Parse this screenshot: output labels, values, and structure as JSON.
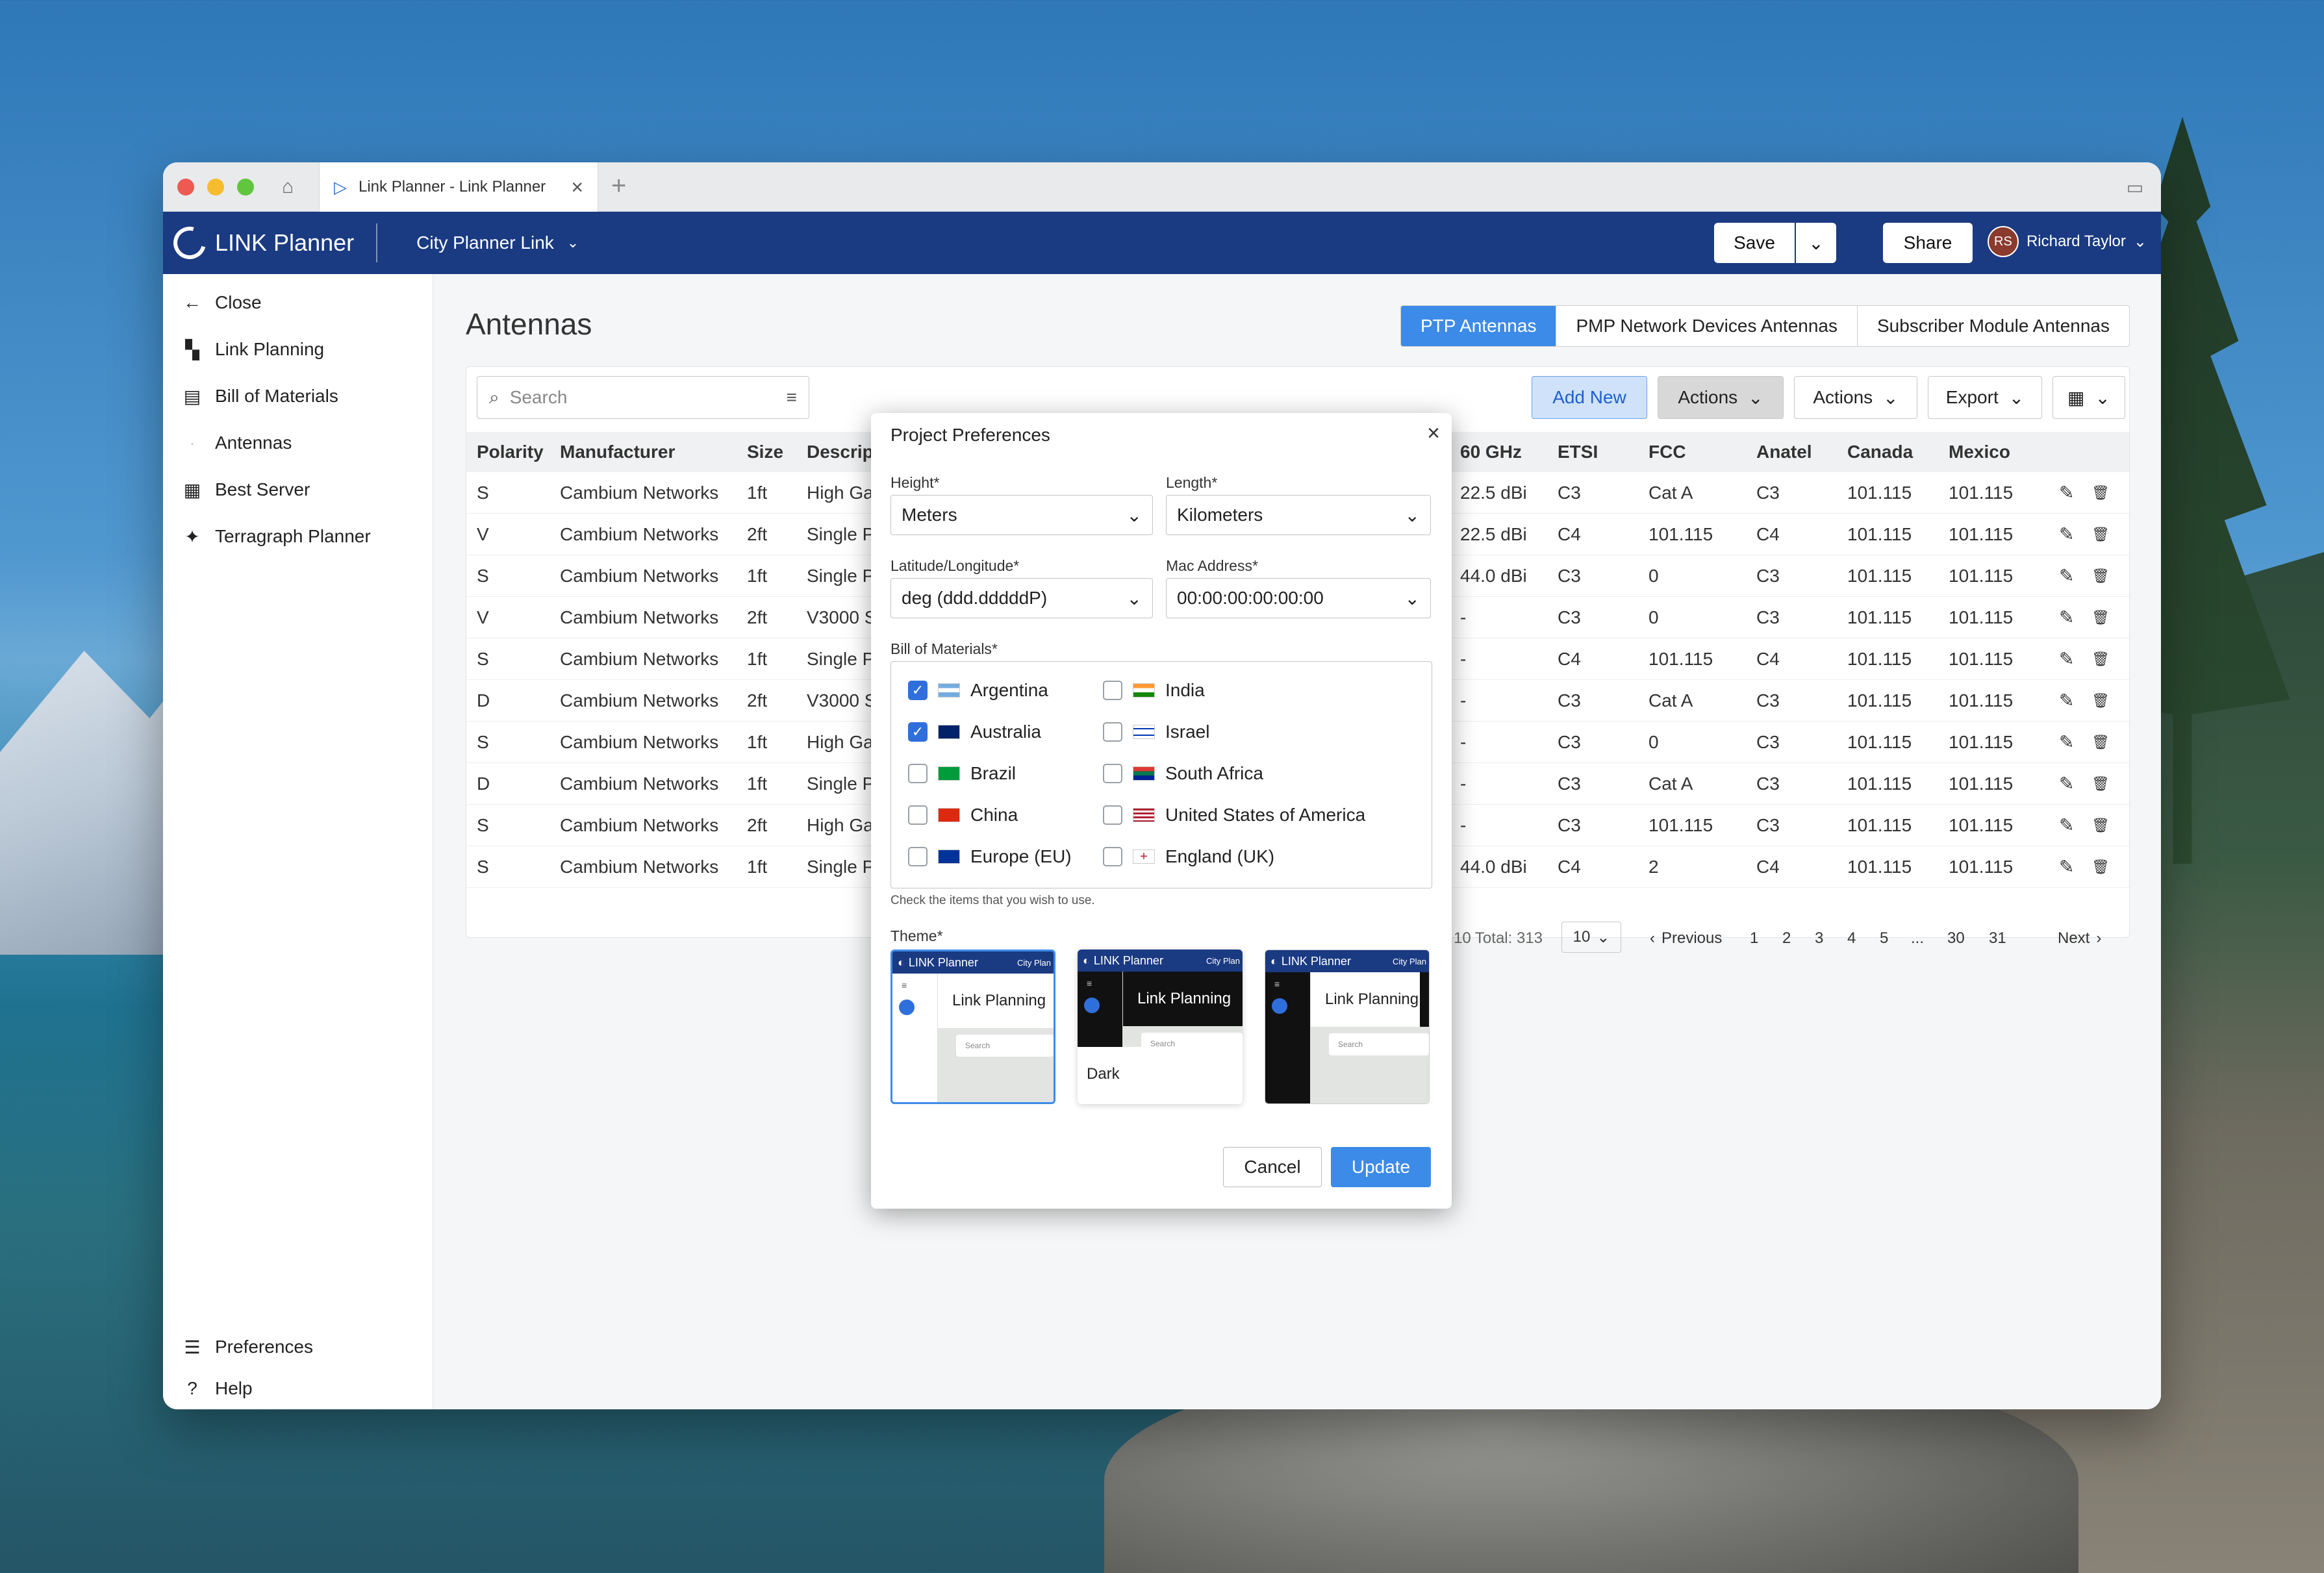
{
  "browser": {
    "tab_title": "Link Planner - Link Planner"
  },
  "app": {
    "logo": "LINK Planner",
    "project": "City Planner Link",
    "save": "Save",
    "share": "Share",
    "user_initials": "RS",
    "user_name": "Richard Taylor"
  },
  "sidebar": {
    "items": [
      {
        "label": "Close",
        "icon": "arrow-left-icon"
      },
      {
        "label": "Link Planning",
        "icon": "map-icon"
      },
      {
        "label": "Bill of Materials",
        "icon": "bom-icon"
      },
      {
        "label": "Antennas",
        "icon": "antenna-icon"
      },
      {
        "label": "Best Server",
        "icon": "server-icon"
      },
      {
        "label": "Terragraph Planner",
        "icon": "puzzle-icon"
      }
    ],
    "bottom": [
      {
        "label": "Preferences",
        "icon": "sliders-icon"
      },
      {
        "label": "Help",
        "icon": "help-icon"
      }
    ]
  },
  "page": {
    "title": "Antennas",
    "tabs": [
      "PTP Antennas",
      "PMP Network Devices Antennas",
      "Subscriber Module Antennas"
    ],
    "search_placeholder": "Search",
    "toolbar": {
      "add_new": "Add New",
      "actions1": "Actions",
      "actions2": "Actions",
      "export": "Export"
    }
  },
  "table": {
    "left_headers": [
      "Polarity",
      "Manufacturer",
      "Size",
      "Descript"
    ],
    "right_headers": [
      "60 GHz",
      "ETSI",
      "FCC",
      "Anatel",
      "Canada",
      "Mexico"
    ],
    "rows": [
      [
        "S",
        "Cambium Networks",
        "1ft",
        "High Ga",
        "22.5 dBi",
        "C3",
        "Cat A",
        "C3",
        "101.115",
        "101.115"
      ],
      [
        "V",
        "Cambium Networks",
        "2ft",
        "Single P",
        "22.5 dBi",
        "C4",
        "101.115",
        "C4",
        "101.115",
        "101.115"
      ],
      [
        "S",
        "Cambium Networks",
        "1ft",
        "Single P",
        "44.0 dBi",
        "C3",
        "0",
        "C3",
        "101.115",
        "101.115"
      ],
      [
        "V",
        "Cambium Networks",
        "2ft",
        "V3000 S",
        "-",
        "C3",
        "0",
        "C3",
        "101.115",
        "101.115"
      ],
      [
        "S",
        "Cambium Networks",
        "1ft",
        "Single P",
        "-",
        "C4",
        "101.115",
        "C4",
        "101.115",
        "101.115"
      ],
      [
        "D",
        "Cambium Networks",
        "2ft",
        "V3000 S",
        "-",
        "C3",
        "Cat A",
        "C3",
        "101.115",
        "101.115"
      ],
      [
        "S",
        "Cambium Networks",
        "1ft",
        "High Ga",
        "-",
        "C3",
        "0",
        "C3",
        "101.115",
        "101.115"
      ],
      [
        "D",
        "Cambium Networks",
        "1ft",
        "Single P",
        "-",
        "C3",
        "Cat A",
        "C3",
        "101.115",
        "101.115"
      ],
      [
        "S",
        "Cambium Networks",
        "2ft",
        "High Ga",
        "-",
        "C3",
        "101.115",
        "C3",
        "101.115",
        "101.115"
      ],
      [
        "S",
        "Cambium Networks",
        "1ft",
        "Single P",
        "44.0 dBi",
        "C4",
        "2",
        "C4",
        "101.115",
        "101.115"
      ]
    ]
  },
  "pagination": {
    "total": "10 Total: 313",
    "page_size": "10",
    "previous": "Previous",
    "pages": [
      "1",
      "2",
      "3",
      "4",
      "5",
      "...",
      "30",
      "31"
    ],
    "next": "Next"
  },
  "modal": {
    "title": "Project Preferences",
    "height_label": "Height",
    "height_value": "Meters",
    "length_label": "Length",
    "length_value": "Kilometers",
    "latlon_label": "Latitude/Longitude",
    "latlon_value": "deg (ddd.dddddP)",
    "mac_label": "Mac Address",
    "mac_value": "00:00:00:00:00:00",
    "bom_label": "Bill of Materials",
    "required_mark": "*",
    "bom_items": [
      {
        "label": "Argentina",
        "checked": true
      },
      {
        "label": "Australia",
        "checked": true
      },
      {
        "label": "Brazil",
        "checked": false
      },
      {
        "label": "China",
        "checked": false
      },
      {
        "label": "Europe (EU)",
        "checked": false
      },
      {
        "label": "India",
        "checked": false
      },
      {
        "label": "Israel",
        "checked": false
      },
      {
        "label": "South Africa",
        "checked": false
      },
      {
        "label": "United States of America",
        "checked": false
      },
      {
        "label": "England (UK)",
        "checked": false
      }
    ],
    "hint": "Check the items that you wish to use.",
    "theme_label": "Theme",
    "theme_preview": {
      "logo": "LINK Planner",
      "project": "City Plan",
      "link": "Link Planning",
      "search": "Search"
    },
    "theme_dark_caption": "Dark",
    "cancel": "Cancel",
    "update": "Update"
  },
  "colors": {
    "appbar": "#1a3a82",
    "accent": "#3d8be8",
    "checkbox": "#2f6fdb"
  }
}
